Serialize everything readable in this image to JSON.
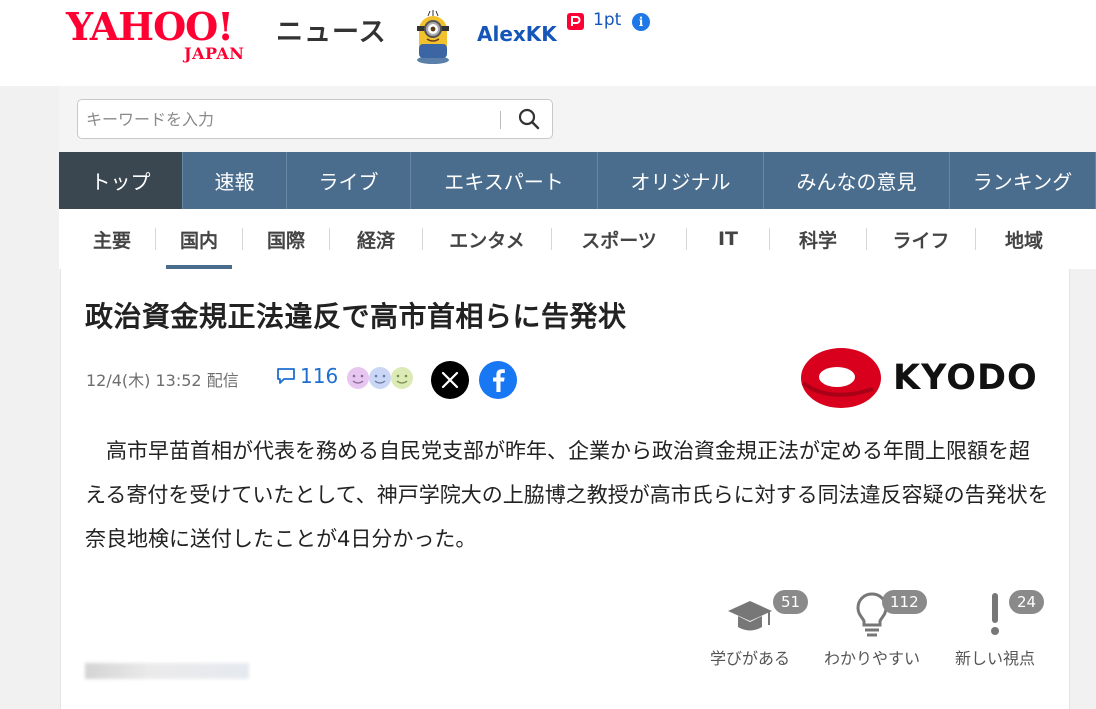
{
  "header": {
    "logo_main": "YAHOO!",
    "logo_sub": "JAPAN",
    "service": "ニュース",
    "username": "AlexKK",
    "points": "1pt",
    "info": "i"
  },
  "search": {
    "placeholder": "キーワードを入力"
  },
  "global_nav": {
    "items": [
      {
        "label": "トップ"
      },
      {
        "label": "速報"
      },
      {
        "label": "ライブ"
      },
      {
        "label": "エキスパート"
      },
      {
        "label": "オリジナル"
      },
      {
        "label": "みんなの意見"
      },
      {
        "label": "ランキング"
      }
    ],
    "active": "トップ"
  },
  "category_nav": {
    "items": [
      {
        "label": "主要"
      },
      {
        "label": "国内"
      },
      {
        "label": "国際"
      },
      {
        "label": "経済"
      },
      {
        "label": "エンタメ"
      },
      {
        "label": "スポーツ"
      },
      {
        "label": "IT"
      },
      {
        "label": "科学"
      },
      {
        "label": "ライフ"
      },
      {
        "label": "地域"
      }
    ],
    "active": "国内"
  },
  "article": {
    "headline": "政治資金規正法違反で高市首相らに告発状",
    "date": "12/4(木) 13:52 配信",
    "comment_count": "116",
    "publisher": "KYODO",
    "body": "高市早苗首相が代表を務める自民党支部が昨年、企業から政治資金規正法が定める年間上限額を超える寄付を受けていたとして、神戸学院大の上脇博之教授が高市氏らに対する同法違反容疑の告発状を奈良地検に送付したことが4日分かった。"
  },
  "reactions": [
    {
      "label": "学びがある",
      "count": "51",
      "icon": "graduation-cap-icon"
    },
    {
      "label": "わかりやすい",
      "count": "112",
      "icon": "lightbulb-icon"
    },
    {
      "label": "新しい視点",
      "count": "24",
      "icon": "exclamation-icon"
    }
  ],
  "colors": {
    "brand_red": "#ff0033",
    "nav_blue": "#4a6d8e",
    "nav_active": "#3a4650",
    "link_blue": "#1556b8",
    "facebook": "#1877f2"
  }
}
